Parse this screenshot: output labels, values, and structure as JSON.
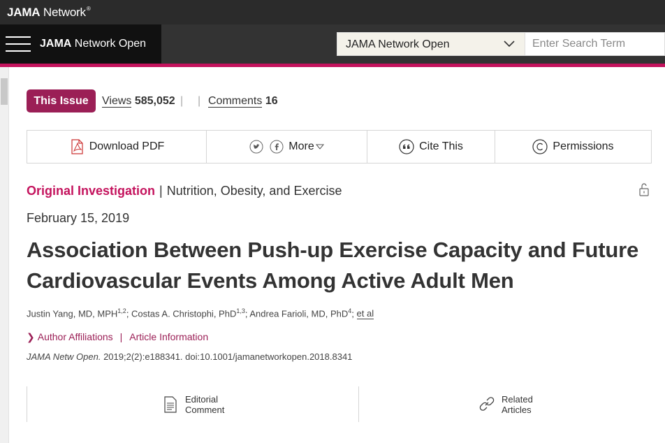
{
  "network": {
    "brand_bold": "JAMA",
    "brand_rest": " Network",
    "reg": "®"
  },
  "header": {
    "journal_bold": "JAMA",
    "journal_rest": " Network Open",
    "select_value": "JAMA Network Open",
    "search_placeholder": "Enter Search Term"
  },
  "issue": {
    "button": "This Issue",
    "views_label": "Views",
    "views_value": "585,052",
    "comments_label": "Comments",
    "comments_value": "16"
  },
  "toolbar": {
    "download": "Download PDF",
    "more": "More",
    "cite": "Cite This",
    "permissions": "Permissions"
  },
  "article": {
    "type": "Original Investigation",
    "topic": "Nutrition, Obesity, and Exercise",
    "date": "February 15, 2019",
    "title": "Association Between Push-up Exercise Capacity and Future Cardiovascular Events Among Active Adult Men",
    "authors": [
      {
        "name": "Justin Yang, MD, MPH",
        "sup": "1,2"
      },
      {
        "name": "Costas A. Christophi, PhD",
        "sup": "1,3"
      },
      {
        "name": "Andrea Farioli, MD, PhD",
        "sup": "4"
      }
    ],
    "et_al": "et al",
    "author_affiliations": "Author Affiliations",
    "article_information": "Article Information",
    "citation_journal": "JAMA Netw Open.",
    "citation_rest": " 2019;2(2):e188341. doi:10.1001/jamanetworkopen.2018.8341"
  },
  "cards": {
    "editorial_line1": "Editorial",
    "editorial_line2": "Comment",
    "related_line1": "Related",
    "related_line2": "Articles"
  },
  "colors": {
    "accent": "#c4135d",
    "issue_button": "#9b1f56",
    "topbar": "#2b2b2b"
  },
  "icons": [
    "pdf-icon",
    "twitter-icon",
    "facebook-icon",
    "quote-icon",
    "copyright-icon",
    "unlock-icon",
    "document-icon",
    "link-icon",
    "menu-icon",
    "chevron-down-icon"
  ]
}
